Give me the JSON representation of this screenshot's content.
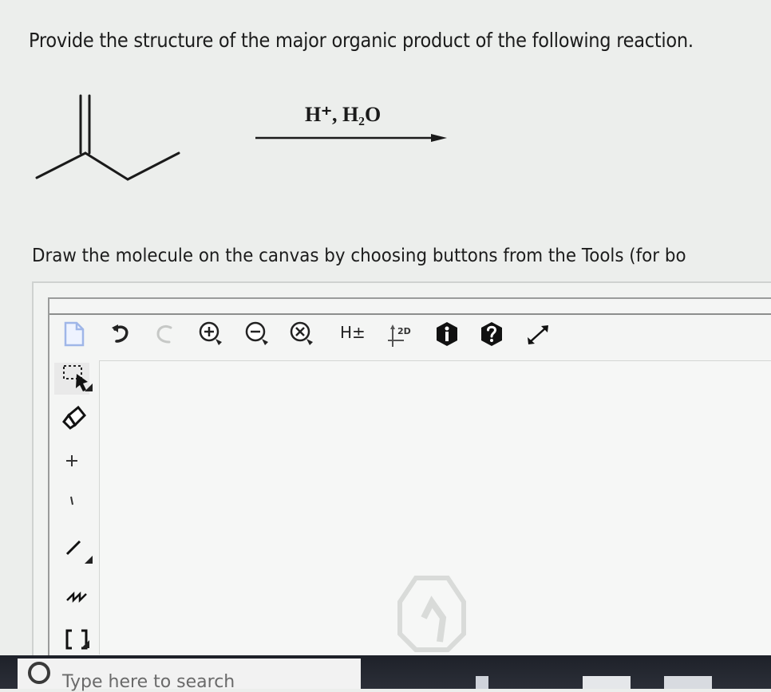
{
  "question": {
    "title": "Provide the structure of the major organic product of the following reaction."
  },
  "reaction": {
    "reagents": "H⁺, H₂O"
  },
  "instructions": {
    "text": "Draw the molecule on the canvas by choosing buttons from the Tools (for bo"
  },
  "toolbar": {
    "h_toggle_label": "H±",
    "label_2d": "2D"
  },
  "taskbar": {
    "search_placeholder": "Type here to search"
  }
}
